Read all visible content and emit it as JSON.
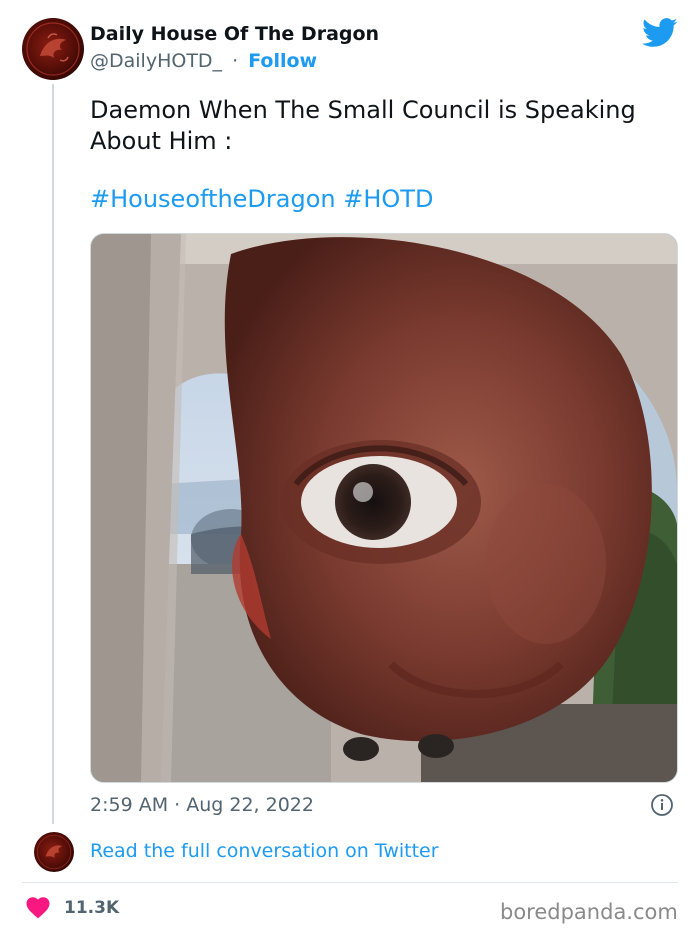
{
  "tweet": {
    "author_name": "Daily House Of The Dragon",
    "handle": "@DailyHOTD_",
    "separator": "·",
    "follow_label": "Follow",
    "text": "Daemon When The Small Council is Speaking About Him :",
    "hashtags": [
      "#HouseoftheDragon",
      "#HOTD"
    ],
    "timestamp": "2:59 AM · Aug 22, 2022",
    "read_more_label": "Read the full conversation on Twitter",
    "like_count": "11.3K"
  },
  "icons": {
    "brand": "twitter-bird-icon",
    "info": "info-icon",
    "like": "heart-icon"
  },
  "watermark": "boredpanda.com",
  "colors": {
    "twitter_blue": "#1d9bf0",
    "like_red": "#f91880",
    "text_primary": "#0f1419",
    "text_secondary": "#536471"
  }
}
